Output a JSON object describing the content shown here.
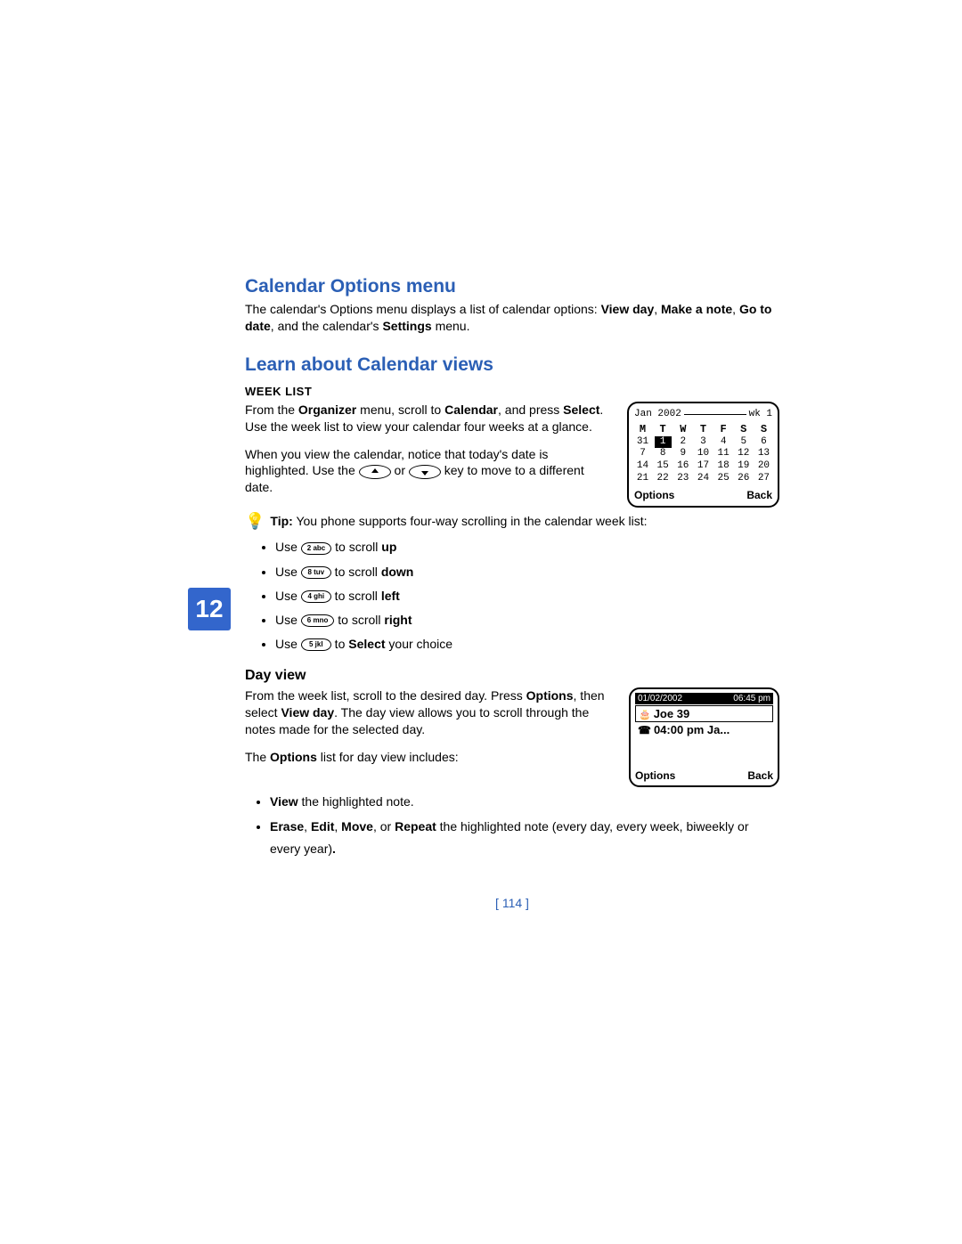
{
  "chapter_number": "12",
  "h1": "Calendar Options menu",
  "p1_a": "The calendar's Options menu displays a list of calendar options: ",
  "p1_b_bold": "View day",
  "p1_c": ", ",
  "p1_d_bold": "Make a note",
  "p1_e": ", ",
  "p1_f_bold": "Go to date",
  "p1_g": ", and the calendar's ",
  "p1_h_bold": "Settings",
  "p1_i": " menu.",
  "h2": "Learn about Calendar views",
  "sub_weeklist": "WEEK LIST",
  "wl_p1_a": "From the ",
  "wl_p1_b_bold": "Organizer",
  "wl_p1_c": " menu, scroll to ",
  "wl_p1_d_bold": "Calendar",
  "wl_p1_e": ", and press ",
  "wl_p1_f_bold": "Select",
  "wl_p1_g": ". Use the week list to view your calendar four weeks at a glance.",
  "wl_p2_a": "When you view the calendar, notice that today's date is highlighted. Use the ",
  "wl_p2_b": " or ",
  "wl_p2_c": " key to move to a different date.",
  "tip_label": "Tip:",
  "tip_text": " You phone supports four-way scrolling in the calendar week list:",
  "scroll": {
    "use": "Use ",
    "k2": "2 abc",
    "up_a": " to scroll ",
    "up_b": "up",
    "k8": "8 tuv",
    "down_a": " to scroll ",
    "down_b": "down",
    "k4": "4 ghi",
    "left_a": " to scroll ",
    "left_b": "left",
    "k6": "6 mno",
    "right_a": " to scroll ",
    "right_b": "right",
    "k5": "5 jkl",
    "sel_a": " to ",
    "sel_b": "Select",
    "sel_c": " your choice"
  },
  "sub_dayview": "Day view",
  "dv_p1_a": "From the week list, scroll to the desired day. Press ",
  "dv_p1_b_bold": "Options",
  "dv_p1_c": ", then select ",
  "dv_p1_d_bold": "View day",
  "dv_p1_e": ". The day view allows you to scroll through the notes made for the selected day.",
  "dv_p2_a": "The ",
  "dv_p2_b_bold": "Options",
  "dv_p2_c": " list for day view includes:",
  "dv_li1_a": "View",
  "dv_li1_b": " the highlighted note.",
  "dv_li2_a": "Erase",
  "dv_li2_b": ", ",
  "dv_li2_c": "Edit",
  "dv_li2_d": ", ",
  "dv_li2_e": "Move",
  "dv_li2_f": ", or ",
  "dv_li2_g": "Repeat",
  "dv_li2_h": " the highlighted note (every day, every week, biweekly or every year)",
  "dv_li2_i": ".",
  "pagenum": "[ 114 ]",
  "weekScreen": {
    "month": "Jan 2002",
    "wk": "wk 1",
    "dow": [
      "M",
      "T",
      "W",
      "T",
      "F",
      "S",
      "S"
    ],
    "rows": [
      [
        "31",
        "1",
        "2",
        "3",
        "4",
        "5",
        "6"
      ],
      [
        "7",
        "8",
        "9",
        "10",
        "11",
        "12",
        "13"
      ],
      [
        "14",
        "15",
        "16",
        "17",
        "18",
        "19",
        "20"
      ],
      [
        "21",
        "22",
        "23",
        "24",
        "25",
        "26",
        "27"
      ]
    ],
    "selected": "1",
    "soft_left": "Options",
    "soft_right": "Back"
  },
  "dayScreen": {
    "date": "01/02/2002",
    "time": "06:45 pm",
    "line1": "Joe 39",
    "line2": "04:00 pm Ja...",
    "soft_left": "Options",
    "soft_right": "Back"
  }
}
